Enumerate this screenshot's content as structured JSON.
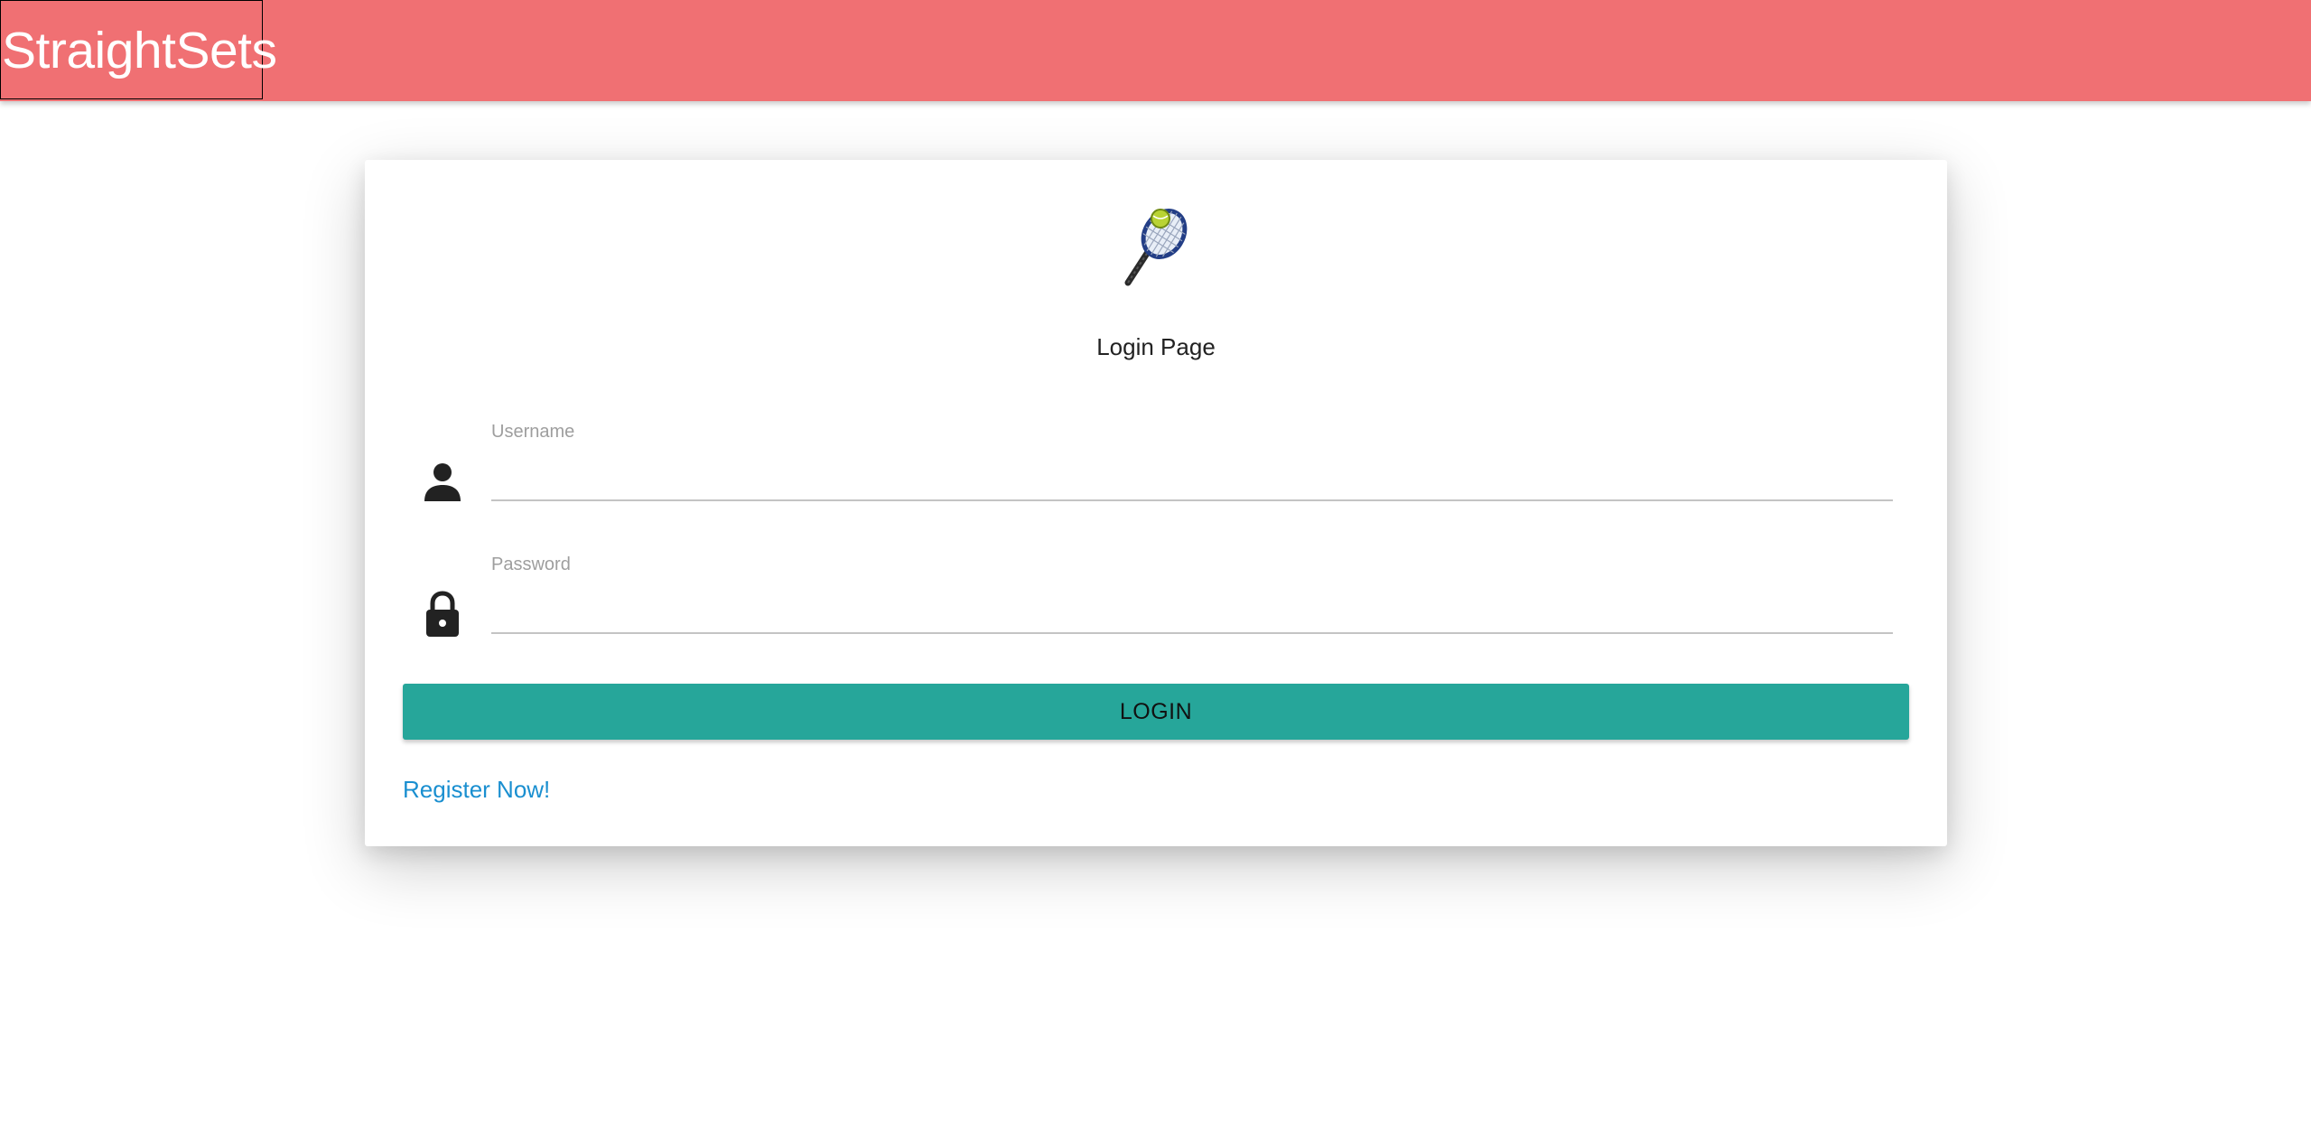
{
  "navbar": {
    "brand": "StraightSets",
    "background_color": "#f07073"
  },
  "login": {
    "logo_icon": "tennis-racket-icon",
    "title": "Login Page",
    "username": {
      "icon": "person-icon",
      "label": "Username",
      "value": ""
    },
    "password": {
      "icon": "lock-icon",
      "label": "Password",
      "value": ""
    },
    "button_label": "LOGIN",
    "button_color": "#26a69a",
    "register_link": "Register Now!",
    "link_color": "#1a8fd0"
  }
}
